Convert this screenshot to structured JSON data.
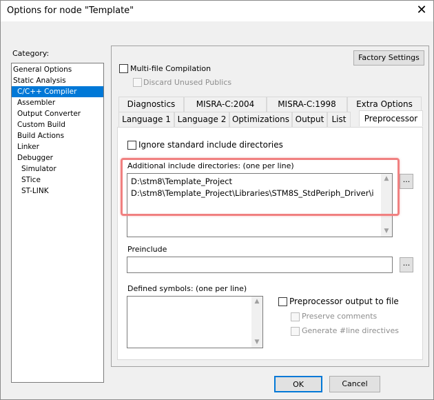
{
  "window": {
    "title": "Options for node \"Template\"",
    "close_glyph": "✕"
  },
  "category": {
    "label": "Category:",
    "items": [
      {
        "label": "General Options",
        "indent": 0
      },
      {
        "label": "Static Analysis",
        "indent": 0
      },
      {
        "label": "C/C++ Compiler",
        "indent": 1,
        "selected": true
      },
      {
        "label": "Assembler",
        "indent": 1
      },
      {
        "label": "Output Converter",
        "indent": 1
      },
      {
        "label": "Custom Build",
        "indent": 1
      },
      {
        "label": "Build Actions",
        "indent": 1
      },
      {
        "label": "Linker",
        "indent": 1
      },
      {
        "label": "Debugger",
        "indent": 1
      },
      {
        "label": "Simulator",
        "indent": 2
      },
      {
        "label": "STice",
        "indent": 2
      },
      {
        "label": "ST-LINK",
        "indent": 2
      }
    ]
  },
  "panel": {
    "factory_settings": "Factory Settings",
    "multi_file": {
      "label": "Multi-file Compilation",
      "checked": false
    },
    "discard_unused": {
      "label": "Discard Unused Publics",
      "checked": false,
      "disabled": true
    },
    "tabs_row1": [
      "Diagnostics",
      "MISRA-C:2004",
      "MISRA-C:1998",
      "Extra Options"
    ],
    "tabs_row2": [
      "Language 1",
      "Language 2",
      "Optimizations",
      "Output",
      "List",
      "Preprocessor"
    ],
    "active_tab": "Preprocessor"
  },
  "preprocessor": {
    "ignore_std": {
      "label": "Ignore standard include directories",
      "checked": false
    },
    "include_dirs_label": "Additional include directories: (one per line)",
    "include_dirs": [
      "D:\\stm8\\Template_Project",
      "D:\\stm8\\Template_Project\\Libraries\\STM8S_StdPeriph_Driver\\i"
    ],
    "browse_label": "...",
    "preinclude_label": "Preinclude",
    "preinclude_value": "",
    "defined_symbols_label": "Defined symbols: (one per line)",
    "preproc_output": {
      "label": "Preprocessor output to file",
      "checked": false
    },
    "preserve_comments": {
      "label": "Preserve comments",
      "checked": false,
      "disabled": true
    },
    "generate_line": {
      "label": "Generate #line directives",
      "checked": false,
      "disabled": true
    }
  },
  "buttons": {
    "ok": "OK",
    "cancel": "Cancel"
  },
  "colors": {
    "selection": "#0078d7",
    "highlight_box": "#f08080"
  }
}
